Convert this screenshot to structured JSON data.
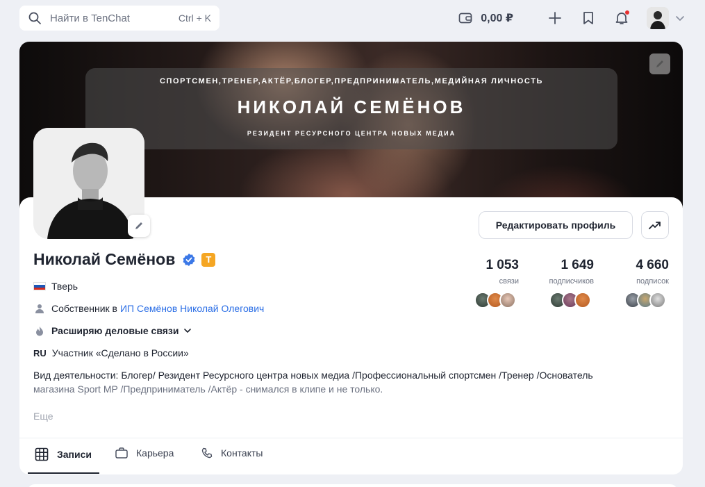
{
  "search": {
    "placeholder": "Найти в TenChat",
    "shortcut": "Ctrl + K"
  },
  "topbar": {
    "wallet_amount": "0,00 ₽"
  },
  "banner": {
    "top_line": "СПОРТСМЕН,ТРЕНЕР,АКТЁР,БЛОГЕР,ПРЕДПРИНИМАТЕЛЬ,МЕДИЙНАЯ ЛИЧНОСТЬ",
    "name": "НИКОЛАЙ СЕМЁНОВ",
    "subline": "РЕЗИДЕНТ РЕСУРСНОГО ЦЕНТРА НОВЫХ МЕДИА"
  },
  "profile": {
    "name": "Николай Семёнов",
    "badge_letter": "T",
    "edit_label": "Редактировать профиль",
    "city": "Тверь",
    "role_prefix": "Собственник в",
    "company": "ИП Семёнов Николай Олегович",
    "goal": "Расширяю деловые связи",
    "ru_label": "RU",
    "participant": "Участник «Сделано в России»",
    "description_main": "Вид деятельности: Блогер/ Резидент Ресурсного центра новых медиа /Профессиональный спортсмен /Тренер /Основатель",
    "description_fade": "магазина Sport MP /Предприниматель /Актёр - снимался в клипе и не только.",
    "more": "Еще"
  },
  "stats": [
    {
      "value": "1 053",
      "label": "связи"
    },
    {
      "value": "1 649",
      "label": "подписчиков"
    },
    {
      "value": "4 660",
      "label": "подписок"
    }
  ],
  "tabs": [
    {
      "label": "Записи"
    },
    {
      "label": "Карьера"
    },
    {
      "label": "Контакты"
    }
  ],
  "colors": {
    "accent": "#2c6fe6",
    "badge": "#f5a623",
    "notification": "#e8302f",
    "background": "#eef0f5"
  }
}
